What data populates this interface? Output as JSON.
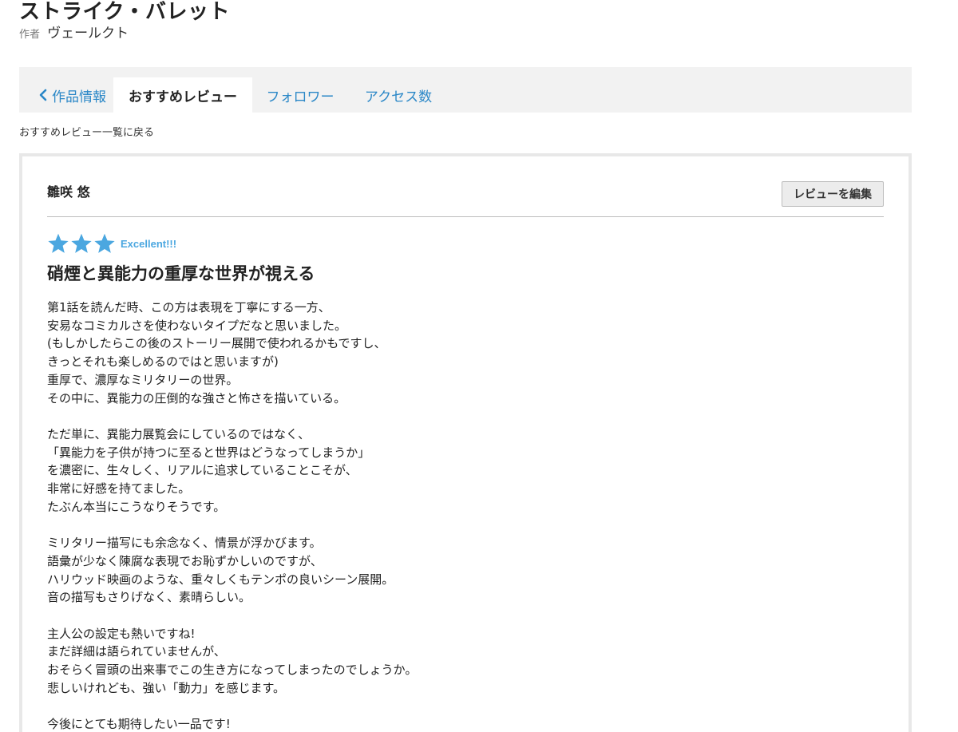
{
  "work": {
    "title": "ストライク・バレット",
    "author_prefix": "作者",
    "author_name": "ヴェールクト"
  },
  "tabs": [
    {
      "label": "作品情報",
      "icon": "chevron-left-icon",
      "active": false
    },
    {
      "label": "おすすめレビュー",
      "active": true
    },
    {
      "label": "フォロワー",
      "active": false
    },
    {
      "label": "アクセス数",
      "active": false
    }
  ],
  "back_link": "おすすめレビュー一覧に戻る",
  "review": {
    "reviewer": "雛咲 悠",
    "edit_label": "レビューを編集",
    "stars": 3,
    "star_color": "#4ba7e0",
    "rating_label": "Excellent!!!",
    "title": "硝煙と異能力の重厚な世界が視える",
    "body": [
      "第1話を読んだ時、この方は表現を丁寧にする一方、",
      "安易なコミカルさを使わないタイプだなと思いました。",
      "(もしかしたらこの後のストーリー展開で使われるかもですし、",
      "きっとそれも楽しめるのではと思いますが)",
      "重厚で、濃厚なミリタリーの世界。",
      "その中に、異能力の圧倒的な強さと怖さを描いている。",
      "",
      "ただ単に、異能力展覧会にしているのではなく、",
      "「異能力を子供が持つに至ると世界はどうなってしまうか」",
      "を濃密に、生々しく、リアルに追求していることこそが、",
      "非常に好感を持てました。",
      "たぶん本当にこうなりそうです。",
      "",
      "ミリタリー描写にも余念なく、情景が浮かびます。",
      "語彙が少なく陳腐な表現でお恥ずかしいのですが、",
      "ハリウッド映画のような、重々しくもテンポの良いシーン展開。",
      "音の描写もさりげなく、素晴らしい。",
      "",
      "主人公の設定も熱いですね!",
      "まだ詳細は語られていませんが、",
      "おそらく冒頭の出来事でこの生き方になってしまったのでしょうか。",
      "悲しいけれども、強い「動力」を感じます。",
      "",
      "今後にとても期待したい一品です!"
    ]
  },
  "colors": {
    "link": "#2a87c7",
    "tabbar_bg": "#f2f2f2",
    "accent": "#4ba7e0"
  }
}
